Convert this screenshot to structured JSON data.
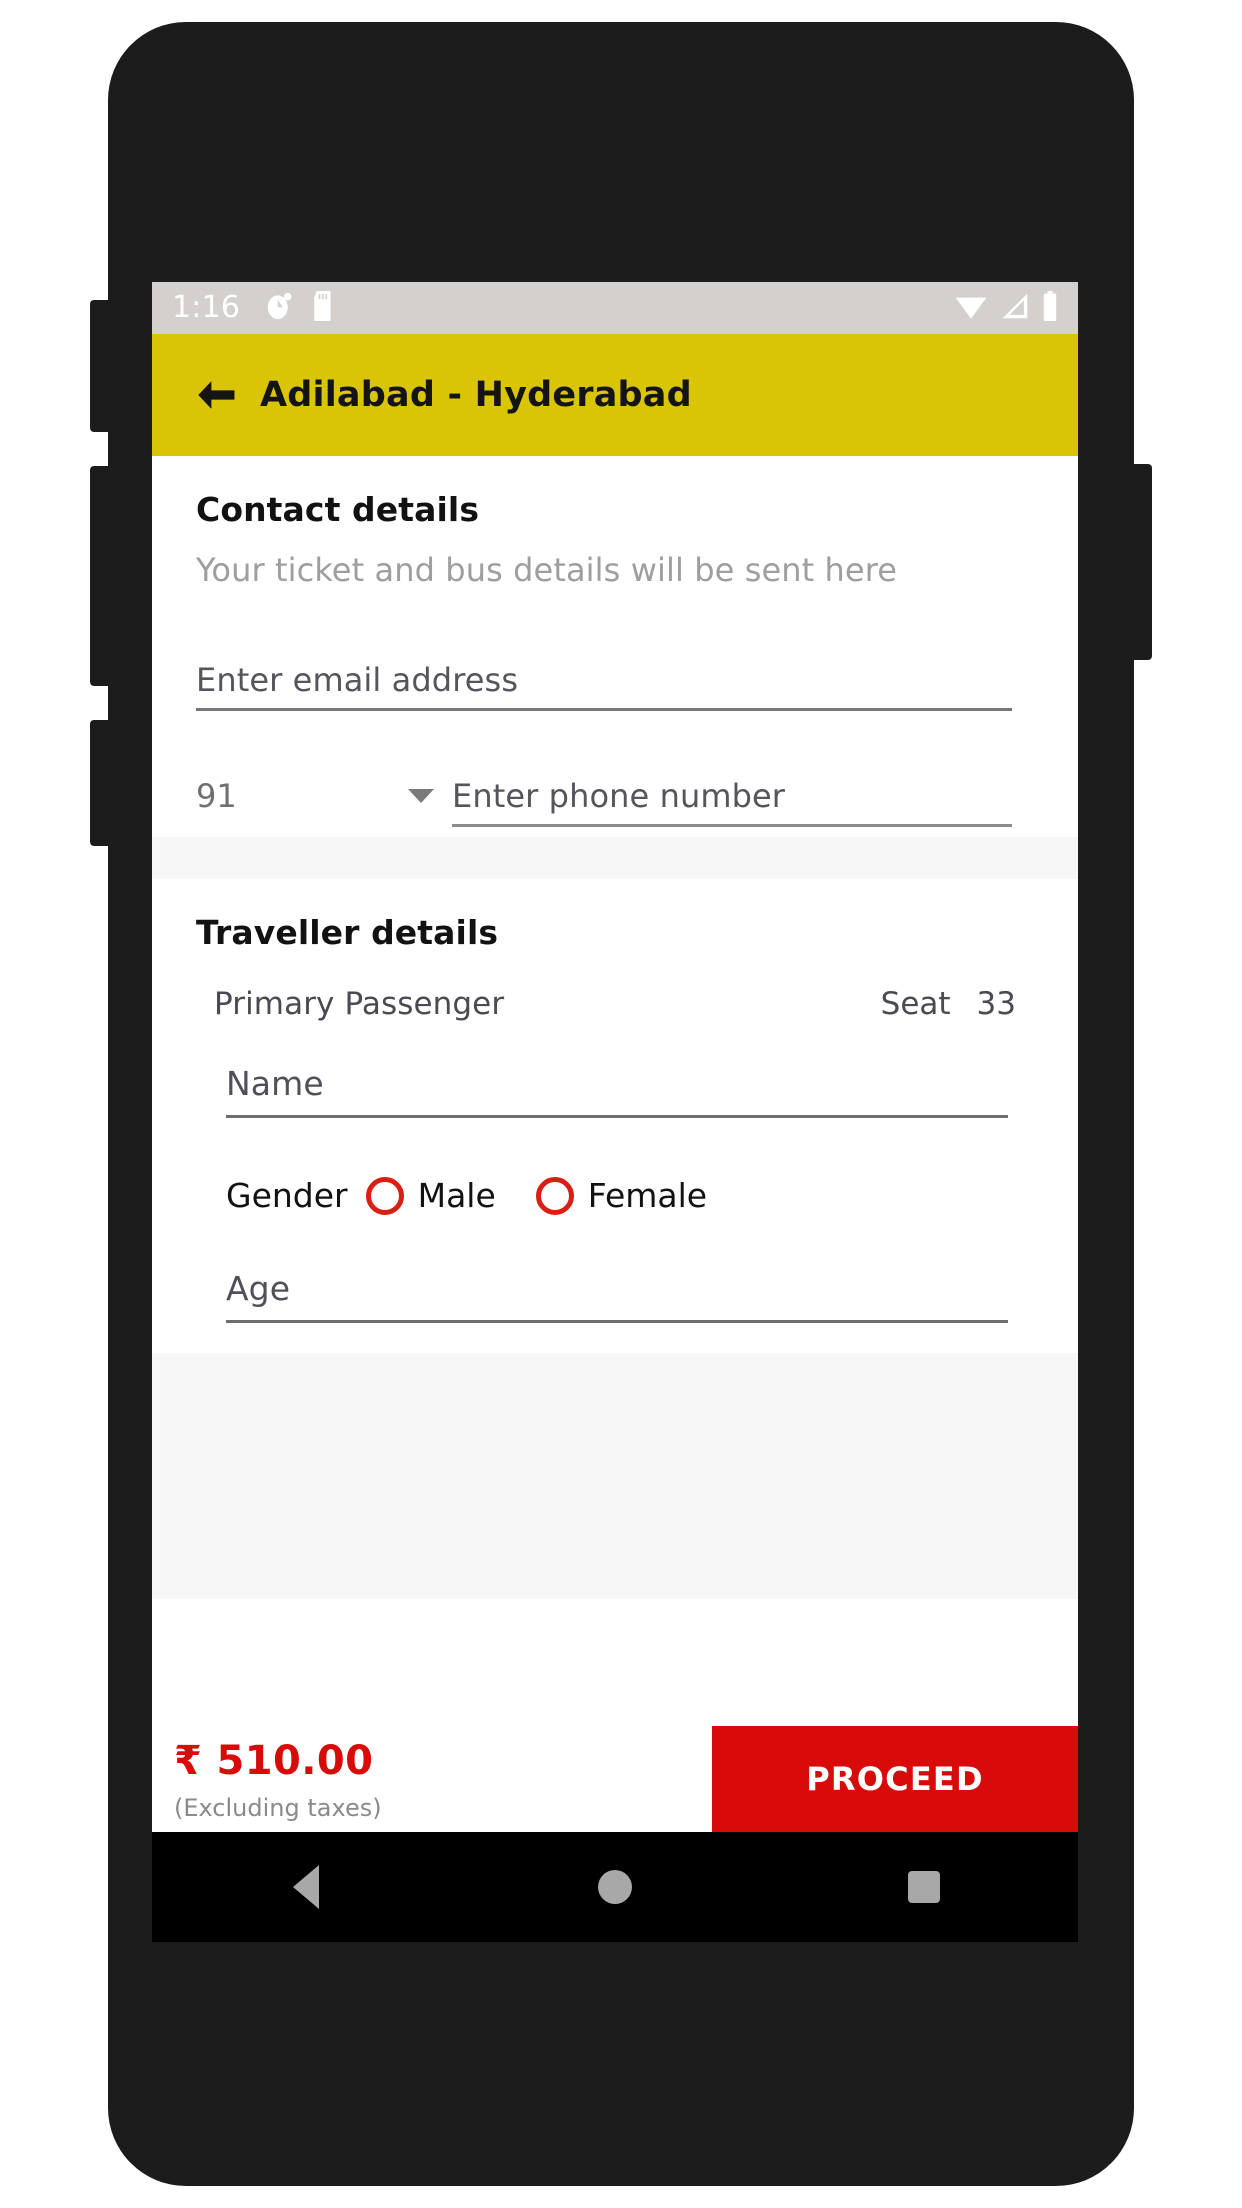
{
  "status_bar": {
    "time": "1:16",
    "left_icons": [
      "alarm-icon",
      "sd-card-icon"
    ],
    "right_icons": [
      "wifi-icon",
      "signal-icon",
      "battery-icon"
    ],
    "background_color": "#d3d0cd"
  },
  "app_bar": {
    "back_icon": "back-arrow-icon",
    "title": "Adilabad - Hyderabad",
    "background_color": "#d9c506"
  },
  "contact": {
    "title": "Contact details",
    "subtitle": "Your ticket and bus details will be sent here",
    "email": {
      "value": "",
      "placeholder": "Enter email address"
    },
    "country_code": {
      "value": "91",
      "icon": "chevron-down-icon"
    },
    "phone": {
      "value": "",
      "placeholder": "Enter phone number"
    }
  },
  "traveller": {
    "title": "Traveller details",
    "passenger_label": "Primary Passenger",
    "seat_label": "Seat",
    "seat_number": "33",
    "name": {
      "value": "",
      "placeholder": "Name"
    },
    "gender": {
      "label": "Gender",
      "options": [
        "Male",
        "Female"
      ],
      "selected": "",
      "accent_color": "#d81f16"
    },
    "age": {
      "value": "",
      "placeholder": "Age"
    }
  },
  "bottom_bar": {
    "price": "₹ 510.00",
    "price_note": "(Excluding taxes)",
    "proceed_label": "PROCEED",
    "accent_color": "#d90a0a"
  },
  "nav_bar": {
    "back": "nav-back-icon",
    "home": "nav-home-icon",
    "recents": "nav-recents-icon"
  }
}
